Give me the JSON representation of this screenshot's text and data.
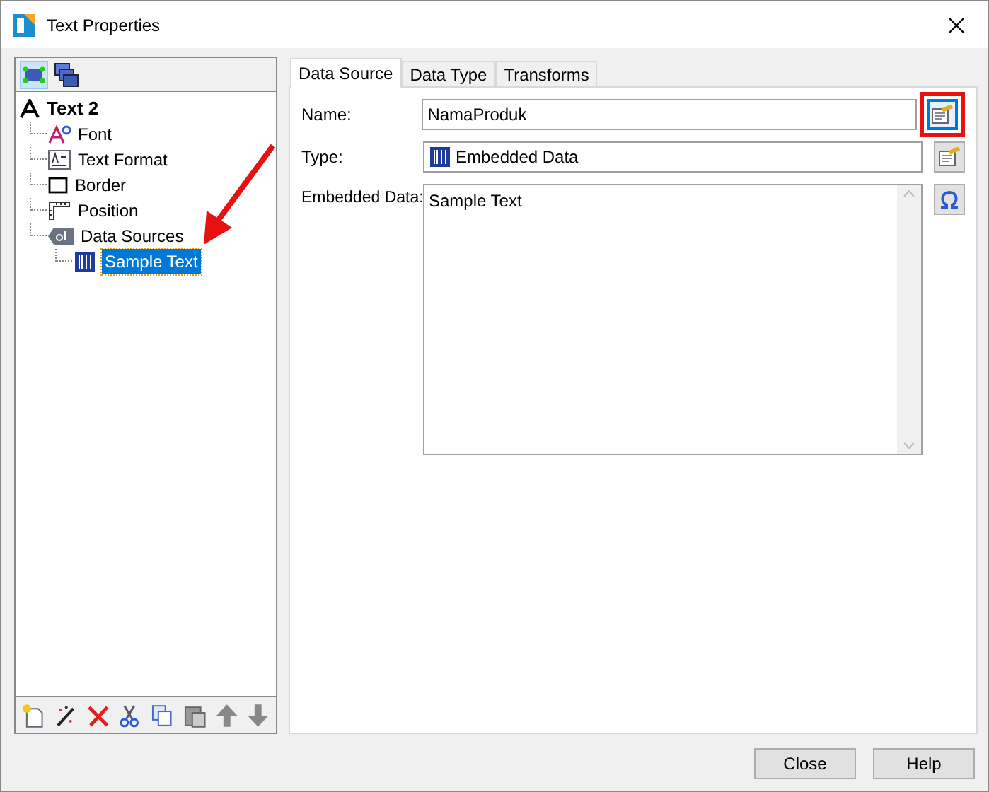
{
  "window": {
    "title": "Text Properties"
  },
  "tree": [
    {
      "label": "Text 2",
      "selected": false,
      "children": [
        {
          "label": "Font",
          "selected": false
        },
        {
          "label": "Text Format",
          "selected": false
        },
        {
          "label": "Border",
          "selected": false
        },
        {
          "label": "Position",
          "selected": false
        },
        {
          "label": "Data Sources",
          "selected": false,
          "children": [
            {
              "label": "Sample Text",
              "selected": true
            }
          ]
        }
      ]
    }
  ],
  "tabs": [
    {
      "label": "Data Source",
      "selected": true
    },
    {
      "label": "Data Type",
      "selected": false
    },
    {
      "label": "Transforms",
      "selected": false
    }
  ],
  "form": {
    "name_label": "Name:",
    "name_value": "NamaProduk",
    "name_button_highlighted": true,
    "type_label": "Type:",
    "type_value": "Embedded Data",
    "embedded_label": "Embedded Data:",
    "embedded_value": "Sample Text"
  },
  "buttons": [
    "Close",
    "Help"
  ]
}
